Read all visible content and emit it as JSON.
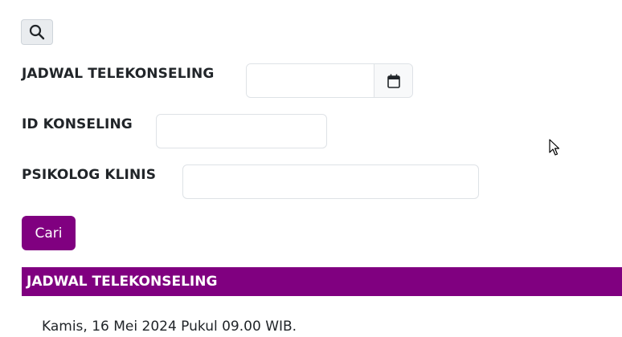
{
  "form": {
    "fields": [
      {
        "label": "JADWAL TELEKONSELING",
        "value": "",
        "placeholder": ""
      },
      {
        "label": "ID KONSELING",
        "value": "",
        "placeholder": ""
      },
      {
        "label": "PSIKOLOG KLINIS",
        "value": "",
        "placeholder": ""
      }
    ],
    "submit_label": "Cari"
  },
  "icons": {
    "search_toggle": "search-icon",
    "date_picker": "calendar-icon"
  },
  "results": {
    "header": "JADWAL TELEKONSELING",
    "items": [
      "Kamis, 16 Mei 2024 Pukul 09.00 WIB."
    ]
  },
  "colors": {
    "accent": "#800080",
    "button_text": "#ffffff"
  }
}
